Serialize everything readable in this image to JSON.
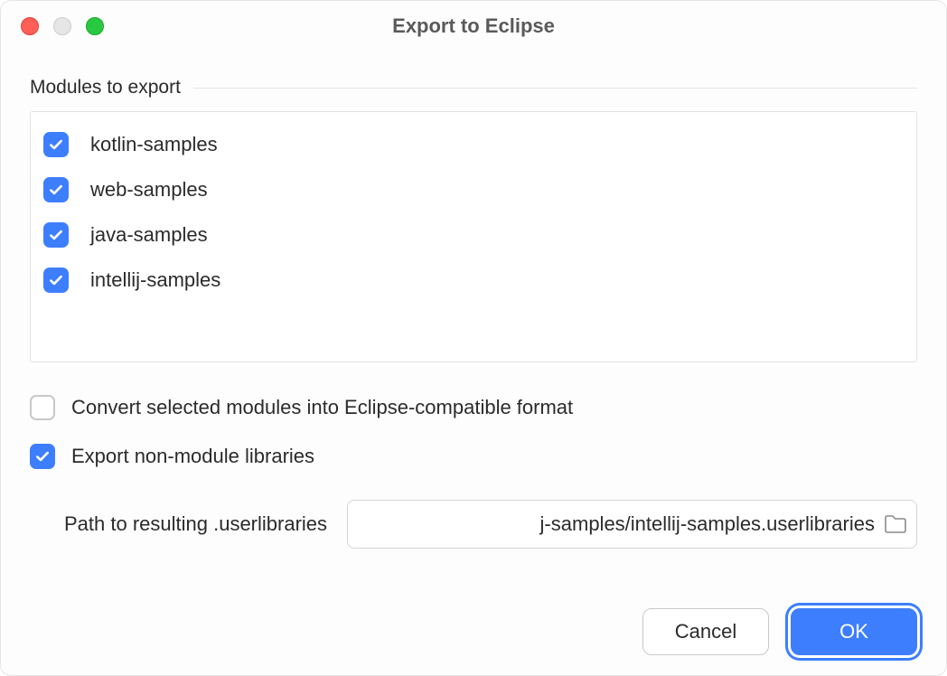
{
  "window": {
    "title": "Export to Eclipse"
  },
  "section": {
    "label": "Modules to export"
  },
  "modules": [
    {
      "label": "kotlin-samples",
      "checked": true
    },
    {
      "label": "web-samples",
      "checked": true
    },
    {
      "label": "java-samples",
      "checked": true
    },
    {
      "label": "intellij-samples",
      "checked": true
    }
  ],
  "options": {
    "convert": {
      "label": "Convert selected modules into Eclipse-compatible format",
      "checked": false
    },
    "export_non_module": {
      "label": "Export non-module libraries",
      "checked": true
    }
  },
  "path": {
    "label": "Path to resulting .userlibraries",
    "value": "j-samples/intellij-samples.userlibraries"
  },
  "buttons": {
    "cancel": "Cancel",
    "ok": "OK"
  }
}
